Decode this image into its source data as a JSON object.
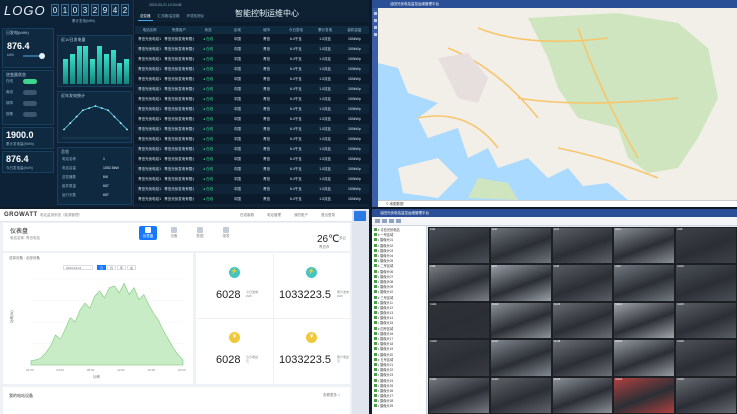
{
  "q1": {
    "logo": "LOGO",
    "digits": [
      "0",
      "1",
      "0",
      "3",
      "2",
      "9",
      "4",
      "2"
    ],
    "digits_sub": "累计发电(kWh)",
    "card_power": {
      "title": "日发电(kWh)",
      "value": "876.4",
      "unit": "kWh"
    },
    "card_status": {
      "title": "逆变器状态",
      "rows": [
        [
          "在线",
          "",
          "#3dd68c"
        ],
        [
          "离线",
          "",
          "#3b566e"
        ],
        [
          "故障",
          "",
          "#3b566e"
        ],
        [
          "报警",
          "",
          "#3b566e"
        ]
      ]
    },
    "card_total": {
      "value": "1900.0",
      "sub": "累计发电量(MWh)"
    },
    "card_total2": {
      "value": "876.4",
      "sub": "今日发电量(kWh)"
    },
    "chart1_title": "近10日发电量",
    "chart1_values": [
      6,
      7,
      9,
      9,
      6,
      9,
      7,
      8,
      5,
      6
    ],
    "chart2_title": "近年发电统计",
    "chart2_values": [
      0.4,
      0.7,
      1.0,
      1.3,
      1.4,
      1.5,
      1.4,
      1.3,
      1.0,
      0.7,
      0.4
    ],
    "info_title": "总览",
    "info_rows": [
      [
        "电站名称",
        "1"
      ],
      [
        "电站容量",
        "1052.5kW"
      ],
      [
        "逆变器数",
        "6/6"
      ],
      [
        "组件数量",
        "657"
      ],
      [
        "运行天数",
        "657"
      ]
    ],
    "date": "2023-03-21  12:04:08",
    "title": "智能控制运维中心",
    "tabs": [
      {
        "label": "逆变器",
        "on": true
      },
      {
        "label": "汇流箱/监控箱",
        "on": false
      },
      {
        "label": "环境检测仪",
        "on": false
      }
    ],
    "columns": [
      "电站名称",
      "所属用户",
      "状态",
      "区域",
      "城市",
      "今日发电",
      "累计发电",
      "装机容量"
    ],
    "row": [
      "青岛光伏电站1",
      "青岛光伏发电有限公司",
      "● 在线",
      "中国",
      "青岛",
      "6.4千瓦",
      "1.0兆瓦",
      "150kWp"
    ],
    "row_count": 18
  },
  "q2": {
    "title": "油田光伏电站监控运维管理平台",
    "status": "© 地图数据"
  },
  "q3": {
    "brand": "GROWATT",
    "brand_sub": "电站监测系统（能源管理）",
    "links": [
      "在线客服",
      "电站管理",
      "我的账户",
      "退出登录"
    ],
    "page_title": "仪表盘",
    "page_sub": "电站名称: 青岛电站",
    "nav": [
      {
        "label": "仪表盘",
        "on": true
      },
      {
        "label": "设备",
        "on": false
      },
      {
        "label": "数据",
        "on": false
      },
      {
        "label": "报表",
        "on": false
      }
    ],
    "temp": "26℃",
    "temp_sub": "多云",
    "temp_sub2": "青岛市",
    "chart_filter": "选择设备 : 全部设备",
    "chart_date": "2023-03-21",
    "chart_btns": [
      {
        "label": "日",
        "on": true
      },
      {
        "label": "月",
        "on": false
      },
      {
        "label": "年",
        "on": false
      },
      {
        "label": "总",
        "on": false
      }
    ],
    "chart_legend": "功率",
    "chart_ylabel": "功率(W)",
    "chart_x": [
      "00:00",
      "04:00",
      "08:00",
      "12:00",
      "16:00",
      "20:00"
    ],
    "chart_values": [
      0.05,
      0.06,
      0.08,
      0.14,
      0.22,
      0.35,
      0.3,
      0.42,
      0.55,
      0.5,
      0.64,
      0.72,
      0.66,
      0.8,
      0.86,
      0.78,
      0.9,
      0.92,
      0.84,
      0.95,
      0.82,
      0.9,
      0.76,
      0.82,
      0.7,
      0.6,
      0.52,
      0.4,
      0.3,
      0.2,
      0.12,
      0.06
    ],
    "kpi": [
      {
        "value": "6028",
        "label1": "今日发电",
        "label2": "kWh",
        "color": "#45c4c4",
        "glyph": "⚡"
      },
      {
        "value": "1033223.5",
        "label1": "累计发电",
        "label2": "kWh",
        "color": "#45c4c4",
        "glyph": "⚡"
      },
      {
        "value": "6028",
        "label1": "今日收益",
        "label2": "元",
        "color": "#f0c93a",
        "glyph": "¥"
      },
      {
        "value": "1033223.5",
        "label1": "累计收益",
        "label2": "元",
        "color": "#f0c93a",
        "glyph": "¥"
      }
    ],
    "bottom_title": "我的电站设备",
    "bottom_link": "查看更多 >"
  },
  "q4": {
    "title": "油田光伏电站监控运维管理平台",
    "tree": [
      "▾ 青岛光伏电站",
      "  ▾ 一号区域",
      "    ▪ 摄像头01",
      "    ▪ 摄像头02",
      "    ▪ 摄像头03",
      "    ▪ 摄像头04",
      "    ▪ 摄像头05",
      "  ▾ 二号区域",
      "    ▪ 摄像头06",
      "    ▪ 摄像头07",
      "    ▪ 摄像头08",
      "    ▪ 摄像头09",
      "    ▪ 摄像头10",
      "  ▾ 三号区域",
      "    ▪ 摄像头11",
      "    ▪ 摄像头12",
      "    ▪ 摄像头13",
      "    ▪ 摄像头14",
      "    ▪ 摄像头15",
      "  ▾ 四号区域",
      "    ▪ 摄像头16",
      "    ▪ 摄像头17",
      "    ▪ 摄像头18",
      "    ▪ 摄像头19",
      "    ▪ 摄像头20",
      "  ▾ 五号区域",
      "    ▪ 摄像头21",
      "    ▪ 摄像头22",
      "    ▪ 摄像头23",
      "    ▪ 摄像头24",
      "    ▪ 摄像头25",
      "    ▪ 摄像头26",
      "    ▪ 摄像头27",
      "    ▪ 摄像头28",
      "    ▪ 摄像头29"
    ],
    "cams": [
      "#4a4f57",
      "#6f757c",
      "#5e6168",
      "#8a8f96",
      "#3e4249",
      "#7c7f84",
      "#9aa1a8",
      "#5a5e64",
      "#747a82",
      "#4b5057",
      "#2e3237",
      "#8f949b",
      "#6a6e74",
      "#a3a7ac",
      "#5b5f66",
      "#3a3e44",
      "#838991",
      "#6d7077",
      "#979ca3",
      "#50545a",
      "#767a80",
      "#606469",
      "#8c9198",
      "#b04040",
      "#676b72"
    ]
  }
}
